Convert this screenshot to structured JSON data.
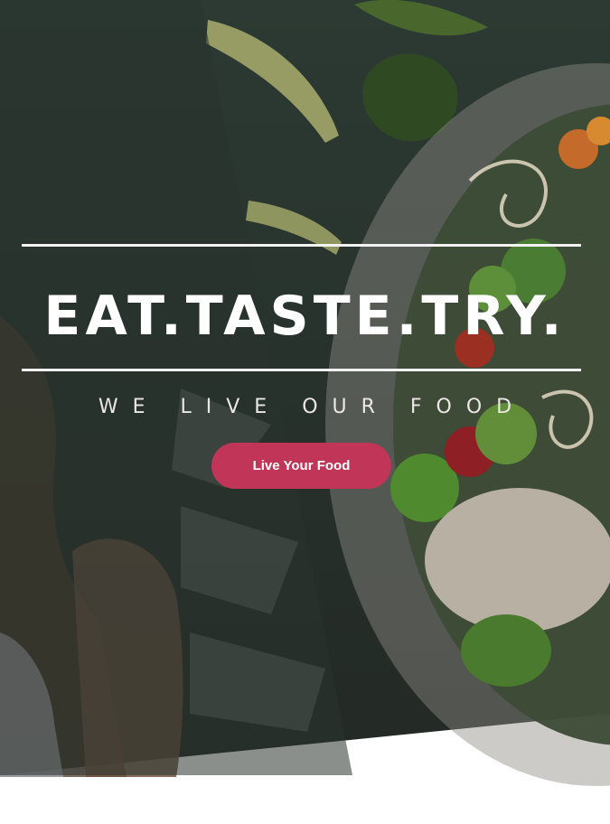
{
  "hero": {
    "headline": "EAT.TASTE.TRY.",
    "tagline": "WE LIVE OUR FOOD",
    "cta_label": "Live Your Food",
    "background_image": "food-bowl-photo",
    "colors": {
      "overlay": "#27302b",
      "rule": "#f2f2f2",
      "headline": "#ffffff",
      "cta": "#c13558"
    }
  }
}
